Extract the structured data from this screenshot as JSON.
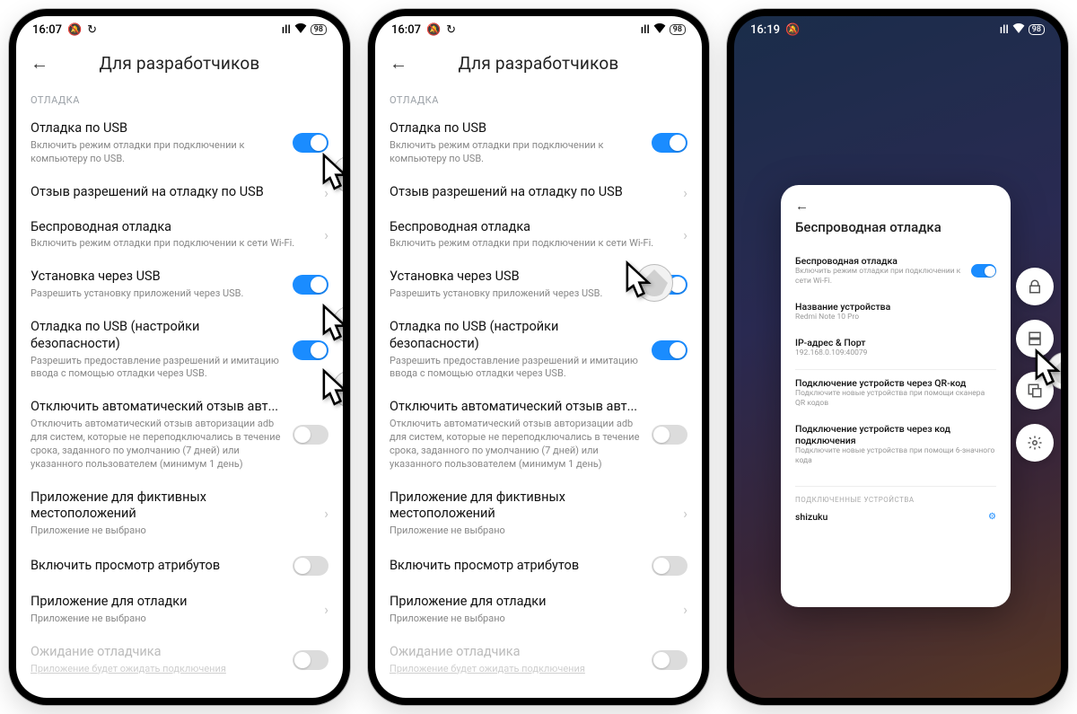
{
  "status": {
    "time_a": "16:07",
    "time_c": "16:19",
    "bell_icon": "🔕",
    "sync_icon": "↺",
    "signal_icon": "📶",
    "wifi_icon": "⋮",
    "battery_text": "98"
  },
  "dev": {
    "page_title": "Для разработчиков",
    "section": "ОТЛАДКА",
    "usb_debug_title": "Отладка по USB",
    "usb_debug_sub": "Включить режим отладки при подключении к компьютеру по USB.",
    "revoke_title": "Отзыв разрешений на отладку по USB",
    "wireless_title": "Беспроводная отладка",
    "wireless_sub": "Включить режим отладки при подключении к сети Wi-Fi.",
    "install_usb_title": "Установка через USB",
    "install_usb_sub": "Разрешить установку приложений через USB.",
    "usb_sec_title": "Отладка по USB (настройки безопасности)",
    "usb_sec_sub": "Разрешить предоставление разрешений и имитацию ввода с помощью отладки через USB.",
    "auto_revoke_title": "Отключить автоматический отзыв авт...",
    "auto_revoke_sub": "Отключить автоматический отзыв авторизации adb для систем, которые не переподключались в течение срока, заданного по умолчанию (7 дней) или указанного пользователем (минимум 1 день)",
    "mock_loc_title": "Приложение для фиктивных местоположений",
    "mock_loc_sub": "Приложение не выбрано",
    "view_attr_title": "Включить просмотр атрибутов",
    "debug_app_title": "Приложение для отладки",
    "debug_app_sub": "Приложение не выбрано",
    "wait_title": "Ожидание отладчика",
    "wait_sub": "Приложение будет ожидать подключения"
  },
  "card": {
    "title": "Беспроводная отладка",
    "row1_title": "Беспроводная отладка",
    "row1_sub": "Включить режим отладки при подключении к сети Wi-Fi.",
    "name_title": "Название устройства",
    "name_sub": "Redmi Note 10 Pro",
    "ip_title": "IP-адрес & Порт",
    "ip_sub": "192.168.0.109:40079",
    "qr_title": "Подключение устройств через QR-код",
    "qr_sub": "Подключите новые устройства при помощи сканера QR кодов",
    "code_title": "Подключение устройств через код подключения",
    "code_sub": "Подключите новые устройства при помощи 6-значного кода",
    "connected_label": "ПОДКЛЮЧЕННЫЕ УСТРОЙСТВА",
    "device": "shizuku"
  }
}
